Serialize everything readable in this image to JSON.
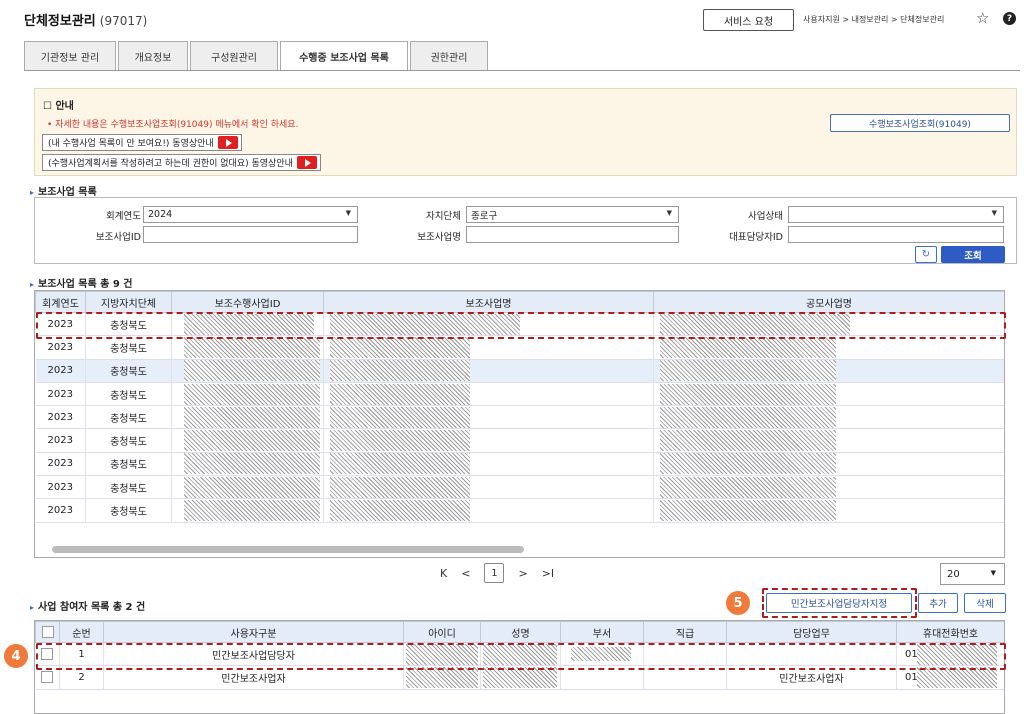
{
  "header": {
    "title": "단체정보관리",
    "code": "(97017)",
    "service_button": "서비스 요청",
    "breadcrumb": "사용자지원 > 내정보관리 > 단체정보관리"
  },
  "tabs": [
    {
      "label": "기관정보 관리"
    },
    {
      "label": "개요정보"
    },
    {
      "label": "구성원관리"
    },
    {
      "label": "수행중 보조사업 목록"
    },
    {
      "label": "권한관리"
    }
  ],
  "notice": {
    "title": "안내",
    "message": "자세한 내용은 수행보조사업조회(91049) 메뉴에서 확인 하세요.",
    "video1": "(내 수행사업 목록이 안 보여요!) 동영상안내",
    "video2": "(수행사업계획서를 작성하려고 하는데 권한이 없대요) 동영상안내",
    "lookup_button": "수행보조사업조회(91049)"
  },
  "filters": {
    "section_title": "보조사업 목록",
    "year_label": "회계연도",
    "year_value": "2024",
    "region_label": "자치단체",
    "region_value": "종로구",
    "status_label": "사업상태",
    "status_value": "",
    "id_label": "보조사업ID",
    "name_label": "보조사업명",
    "manager_label": "대표담당자ID",
    "search_button": "조회"
  },
  "grid1": {
    "title": "보조사업 목록  총 9 건",
    "columns": [
      "회계연도",
      "지방자치단체",
      "보조수행사업ID",
      "보조사업명",
      "공모사업명"
    ],
    "rows": [
      [
        "2023",
        "충청북도"
      ],
      [
        "2023",
        "충청북도"
      ],
      [
        "2023",
        "충청북도"
      ],
      [
        "2023",
        "충청북도"
      ],
      [
        "2023",
        "충청북도"
      ],
      [
        "2023",
        "충청북도"
      ],
      [
        "2023",
        "충청북도"
      ],
      [
        "2023",
        "충청북도"
      ],
      [
        "2023",
        "충청북도"
      ]
    ]
  },
  "pager": {
    "first": "K",
    "prev": "<",
    "current": "1",
    "next": ">",
    "last": ">I",
    "page_size": "20"
  },
  "grid2": {
    "title": "사업 참여자 목록  총 2 건",
    "assign_button": "민간보조사업담당자지정",
    "add_button": "추가",
    "delete_button": "삭제",
    "columns": [
      "순번",
      "사용자구분",
      "아이디",
      "성명",
      "부서",
      "직급",
      "담당업무",
      "휴대전화번호"
    ],
    "rows": [
      {
        "no": "1",
        "type": "민간보조사업담당자",
        "duty": "",
        "phone": "01"
      },
      {
        "no": "2",
        "type": "민간보조사업자",
        "duty": "민간보조사업자",
        "phone": "01"
      }
    ]
  },
  "markers": {
    "m4": "4",
    "m5": "5"
  }
}
